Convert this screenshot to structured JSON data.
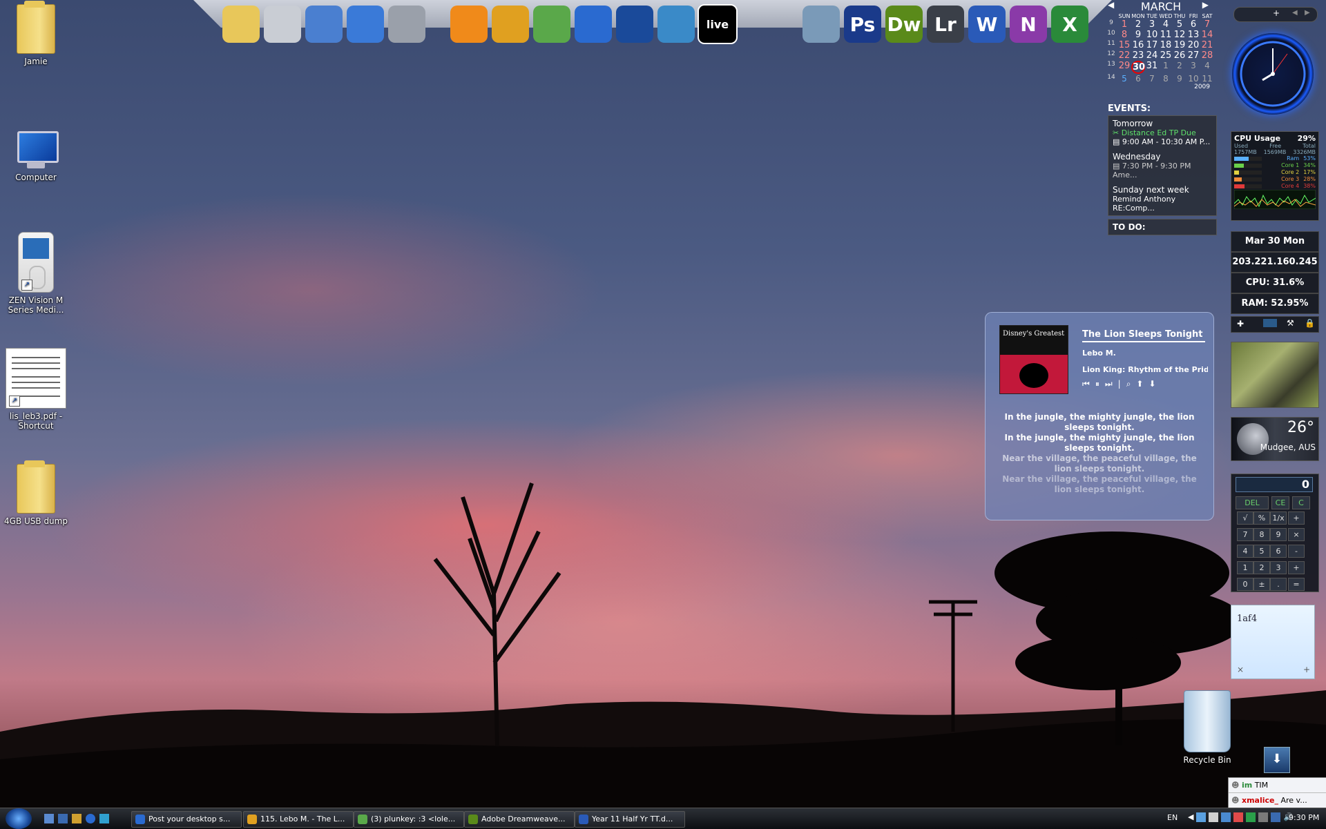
{
  "desktop_icons": [
    {
      "label": "Jamie",
      "icon": "user-folder-icon"
    },
    {
      "label": "Computer",
      "icon": "computer-icon"
    },
    {
      "label": "ZEN Vision M Series Medi...",
      "icon": "zen-player-icon"
    },
    {
      "label": "lis_leb3.pdf - Shortcut",
      "icon": "pdf-icon"
    },
    {
      "label": "4GB USB dump",
      "icon": "folder-icon"
    }
  ],
  "dock": {
    "apps": [
      {
        "name": "folder-icon",
        "glyph": "",
        "color": "#e8c75a"
      },
      {
        "name": "drive-icon",
        "glyph": "",
        "color": "#c9cdd4"
      },
      {
        "name": "computer-icon",
        "glyph": "",
        "color": "#4a7fd0"
      },
      {
        "name": "network-icon",
        "glyph": "",
        "color": "#3a7ad8"
      },
      {
        "name": "microphone-icon",
        "glyph": "",
        "color": "#9aa0aa"
      },
      {
        "name": "vlc-icon",
        "glyph": "",
        "color": "#f08a1a"
      },
      {
        "name": "torrent-icon",
        "glyph": "",
        "color": "#e0a020"
      },
      {
        "name": "messenger-icon",
        "glyph": "",
        "color": "#5aa84a"
      },
      {
        "name": "browser-icon",
        "glyph": "",
        "color": "#2a6ad0"
      },
      {
        "name": "thunderbird-icon",
        "glyph": "",
        "color": "#1a4a9a"
      },
      {
        "name": "network-tool-icon",
        "glyph": "",
        "color": "#3a8ac8"
      },
      {
        "name": "ableton-live-icon",
        "glyph": "live",
        "color": "#000000"
      },
      {
        "name": "virtualbox-icon",
        "glyph": "",
        "color": "#7a9ab8"
      },
      {
        "name": "photoshop-icon",
        "glyph": "Ps",
        "color": "#1a3a8a"
      },
      {
        "name": "dreamweaver-icon",
        "glyph": "Dw",
        "color": "#5a8a1a"
      },
      {
        "name": "lightroom-icon",
        "glyph": "Lr",
        "color": "#3a3f48"
      },
      {
        "name": "word-icon",
        "glyph": "W",
        "color": "#2a5ab8"
      },
      {
        "name": "onenote-icon",
        "glyph": "N",
        "color": "#8a3aa8"
      },
      {
        "name": "excel-icon",
        "glyph": "X",
        "color": "#2a8a3a"
      }
    ]
  },
  "calendar": {
    "month": "MARCH",
    "year": "2009",
    "weekdays": [
      "SUN",
      "MON",
      "TUE",
      "WED",
      "THU",
      "FRI",
      "SAT"
    ],
    "weeks": [
      {
        "wk": "9",
        "days": [
          "1",
          "2",
          "3",
          "4",
          "5",
          "6",
          "7"
        ]
      },
      {
        "wk": "10",
        "days": [
          "8",
          "9",
          "10",
          "11",
          "12",
          "13",
          "14"
        ]
      },
      {
        "wk": "11",
        "days": [
          "15",
          "16",
          "17",
          "18",
          "19",
          "20",
          "21"
        ]
      },
      {
        "wk": "12",
        "days": [
          "22",
          "23",
          "24",
          "25",
          "26",
          "27",
          "28"
        ]
      },
      {
        "wk": "13",
        "days": [
          "29",
          "30",
          "31",
          "1",
          "2",
          "3",
          "4"
        ]
      },
      {
        "wk": "14",
        "days": [
          "5",
          "6",
          "7",
          "8",
          "9",
          "10",
          "11"
        ]
      }
    ],
    "today": "30"
  },
  "events": {
    "heading": "EVENTS:",
    "groups": [
      {
        "when": "Tomorrow",
        "items": [
          "Distance Ed TP Due",
          "9:00 AM - 10:30 AM P..."
        ]
      },
      {
        "when": "Wednesday",
        "items": [
          "7:30 PM - 9:30 PM Ame..."
        ]
      },
      {
        "when": "Sunday next week",
        "items": [
          "Remind Anthony RE:Comp..."
        ]
      }
    ],
    "todo_heading": "TO DO:"
  },
  "cpu_meter": {
    "title": "CPU Usage",
    "percent": "29%",
    "mem_headers": [
      "Used",
      "Free",
      "Total"
    ],
    "mem_values": [
      "1757MB",
      "1569MB",
      "3326MB"
    ],
    "bars": [
      {
        "label": "Ram",
        "value": "53%",
        "color": "#5ab0ff"
      },
      {
        "label": "Core 1",
        "value": "34%",
        "color": "#6ad04a"
      },
      {
        "label": "Core 2",
        "value": "17%",
        "color": "#e0d040"
      },
      {
        "label": "Core 3",
        "value": "28%",
        "color": "#f08a3a"
      },
      {
        "label": "Core 4",
        "value": "38%",
        "color": "#e03a3a"
      }
    ]
  },
  "system_stats": {
    "date": "Mar 30 Mon",
    "ip": "203.221.160.245",
    "cpu": "CPU: 31.6%",
    "ram": "RAM: 52.95%"
  },
  "weather": {
    "temp": "26°",
    "city": "Mudgee, AUS"
  },
  "calculator": {
    "display": "0",
    "keys": [
      "DEL",
      "CE",
      "C",
      "√",
      "%",
      "1/x",
      "+",
      "7",
      "8",
      "9",
      "×",
      "4",
      "5",
      "6",
      "-",
      "1",
      "2",
      "3",
      "+",
      "0",
      "±",
      ".",
      "="
    ]
  },
  "sticky_note": {
    "text": "1af4",
    "close": "×",
    "add": "+"
  },
  "player": {
    "album_art_text": "Disney's Greatest",
    "track": "The Lion Sleeps Tonight",
    "artist": "Lebo M.",
    "album": "Lion King: Rhythm of the Pride L",
    "lyrics": [
      "In the jungle, the mighty jungle, the lion sleeps tonight.",
      "In the jungle, the mighty jungle, the lion sleeps tonight.",
      "Near the village, the peaceful village, the lion sleeps tonight.",
      "Near the village, the peaceful village, the lion sleeps tonight."
    ]
  },
  "recycle_bin": {
    "label": "Recycle Bin"
  },
  "messenger_popup": {
    "row1": "TIM",
    "row2_name": "xmalice_",
    "row2_msg": "Are v..."
  },
  "taskbar": {
    "tasks": [
      {
        "label": "Post your desktop s...",
        "color": "#2a6ad0"
      },
      {
        "label": "115. Lebo M. - The L...",
        "color": "#e0a020"
      },
      {
        "label": "(3) plunkey: :3 <lole...",
        "color": "#5aa84a"
      },
      {
        "label": "Adobe Dreamweave...",
        "color": "#5a8a1a"
      },
      {
        "label": "Year 11 Half Yr TT.d...",
        "color": "#2a5ab8"
      }
    ],
    "language": "EN",
    "time": "9:30 PM"
  }
}
